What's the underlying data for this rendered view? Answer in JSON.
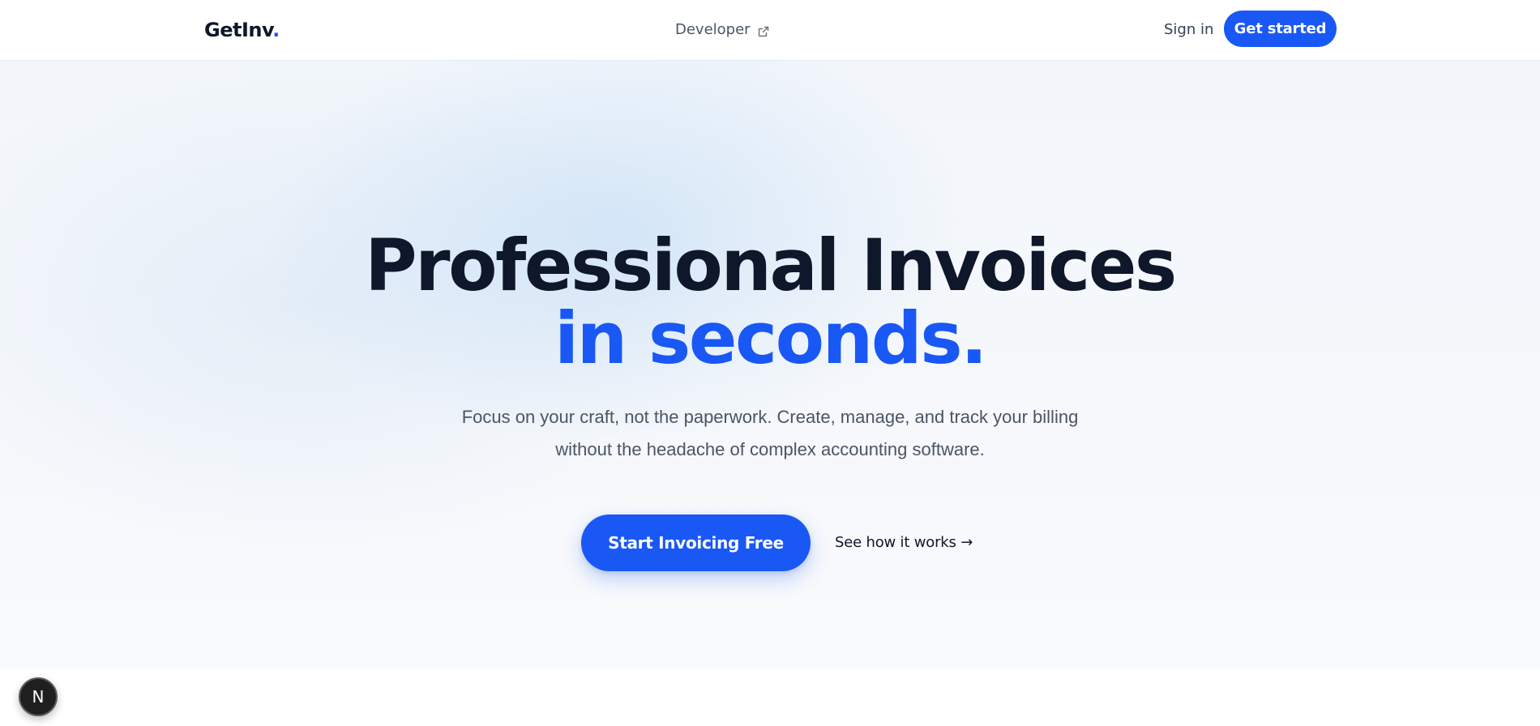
{
  "header": {
    "logo_text": "GetInv",
    "logo_dot": ".",
    "developer_link": "Developer",
    "sign_in": "Sign in",
    "get_started": "Get started"
  },
  "hero": {
    "headline_line1": "Professional Invoices",
    "headline_line2": "in seconds.",
    "subtext_line1": "Focus on your craft, not the paperwork. Create, manage, and track your billing",
    "subtext_line2": "without the headache of complex accounting software.",
    "cta_primary": "Start Invoicing Free",
    "cta_secondary": "See how it works →"
  },
  "badge": {
    "label": "N"
  },
  "icons": {
    "developer_link_icon": "external-link-icon"
  },
  "colors": {
    "brand_blue": "#1958f5",
    "heading_dark": "#0f172a",
    "body_gray": "#4b5566"
  }
}
